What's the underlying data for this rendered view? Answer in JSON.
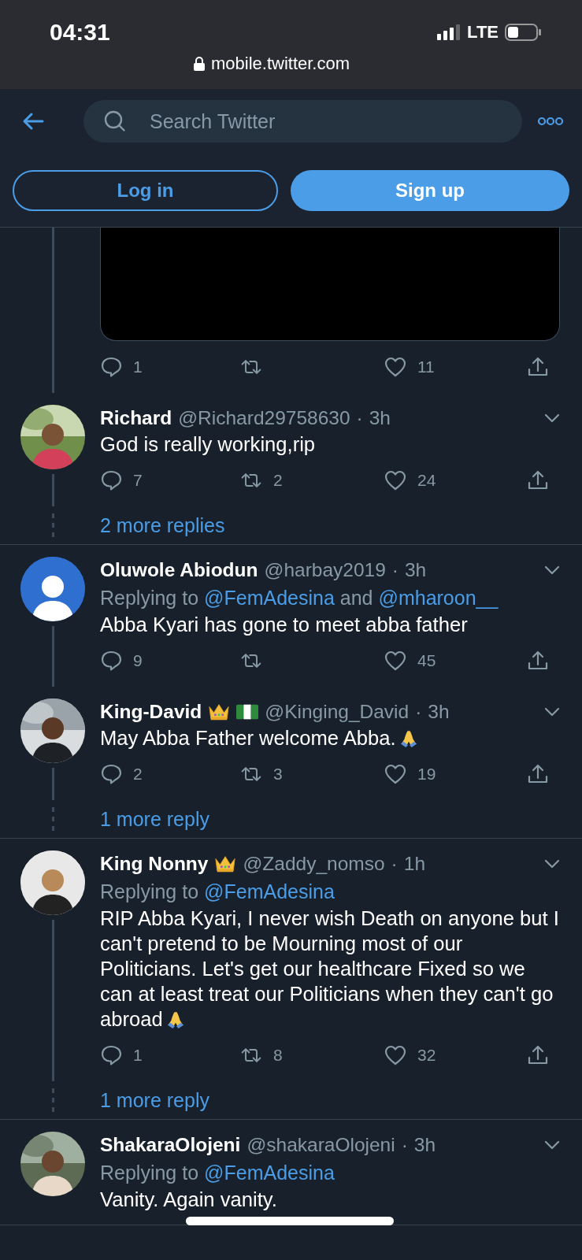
{
  "status_bar": {
    "time": "04:31",
    "network": "LTE",
    "url": "mobile.twitter.com"
  },
  "header": {
    "search": {
      "placeholder": "Search Twitter"
    },
    "login": "Log in",
    "signup": "Sign up"
  },
  "threads": [
    {
      "tweets": [
        {
          "kind": "media-tail",
          "actions": {
            "replies": "1",
            "likes": "11"
          }
        },
        {
          "kind": "tweet",
          "name": "Richard",
          "handle": "@Richard29758630",
          "dot": "·",
          "time": "3h",
          "text": "God is really working,rip",
          "actions": {
            "replies": "7",
            "retweets": "2",
            "likes": "24"
          }
        }
      ],
      "more": "2 more replies"
    },
    {
      "tweets": [
        {
          "kind": "tweet",
          "name": "Oluwole Abiodun",
          "handle": "@harbay2019",
          "dot": "·",
          "time": "3h",
          "replying": {
            "label": "Replying to",
            "users": [
              "@FemAdesina",
              "@mharoon__"
            ],
            "joiner": "and"
          },
          "text": "Abba Kyari has gone to meet abba father",
          "actions": {
            "replies": "9",
            "likes": "45"
          }
        },
        {
          "kind": "tweet",
          "name": "King-David",
          "badges": [
            {
              "kind": "crown"
            },
            {
              "kind": "flag"
            }
          ],
          "handle": "@Kinging_David",
          "dot": "·",
          "time": "3h",
          "text": "May Abba Father welcome Abba.",
          "prayer_emoji": true,
          "actions": {
            "replies": "2",
            "retweets": "3",
            "likes": "19"
          }
        }
      ],
      "more": "1 more reply"
    },
    {
      "tweets": [
        {
          "kind": "tweet",
          "name": "King Nonny",
          "badges": [
            {
              "kind": "crown"
            }
          ],
          "handle": "@Zaddy_nomso",
          "dot": "·",
          "time": "1h",
          "replying": {
            "label": "Replying to",
            "users": [
              "@FemAdesina"
            ]
          },
          "text": "RIP Abba Kyari, I never wish Death on anyone but I can't pretend to be Mourning most of our Politicians. Let's get our healthcare Fixed so we can at least treat our Politicians when they can't go abroad",
          "prayer_emoji": true,
          "actions": {
            "replies": "1",
            "retweets": "8",
            "likes": "32"
          }
        }
      ],
      "more": "1 more reply"
    },
    {
      "tweets": [
        {
          "kind": "tweet",
          "name": "ShakaraOlojeni",
          "handle": "@shakaraOlojeni",
          "dot": "·",
          "time": "3h",
          "replying": {
            "label": "Replying to",
            "users": [
              "@FemAdesina"
            ]
          },
          "text": "Vanity. Again vanity."
        }
      ]
    }
  ]
}
